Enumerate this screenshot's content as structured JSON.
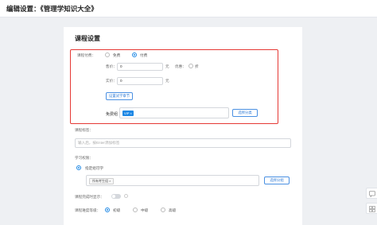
{
  "header": {
    "title": "编辑设置：《管理学知识大全》"
  },
  "card": {
    "title": "课程设置"
  },
  "course_type": {
    "label": "课程付费：",
    "options": [
      "免费",
      "付费"
    ],
    "selected": "付费"
  },
  "pricing": {
    "price_label": "售价：",
    "price_value": "0",
    "price_unit": "元",
    "discount_label": "优惠：",
    "discount_unit": "折",
    "actual_label": "实价：",
    "actual_value": "0",
    "actual_unit": "元",
    "set_trial_button": "设置试学章节"
  },
  "free_group": {
    "label": "免费组",
    "tag": "VIP",
    "select_button": "选择分类"
  },
  "tags": {
    "label": "课程标签：",
    "placeholder": "输入后，按Enter添加标签"
  },
  "permission": {
    "label": "学习权限：",
    "option": "指定组可学",
    "group_tag": "所有考生组",
    "select_button": "选择分组"
  },
  "completion": {
    "label": "课程完成时显示："
  },
  "difficulty": {
    "label": "课程难度等级：",
    "options": [
      "初级",
      "中级",
      "高级"
    ],
    "selected": "初级"
  },
  "colors": {
    "accent": "#1e88e5",
    "highlight": "#e53935"
  },
  "icons": {
    "side_tools": [
      "feedback-icon",
      "grid-icon"
    ]
  }
}
